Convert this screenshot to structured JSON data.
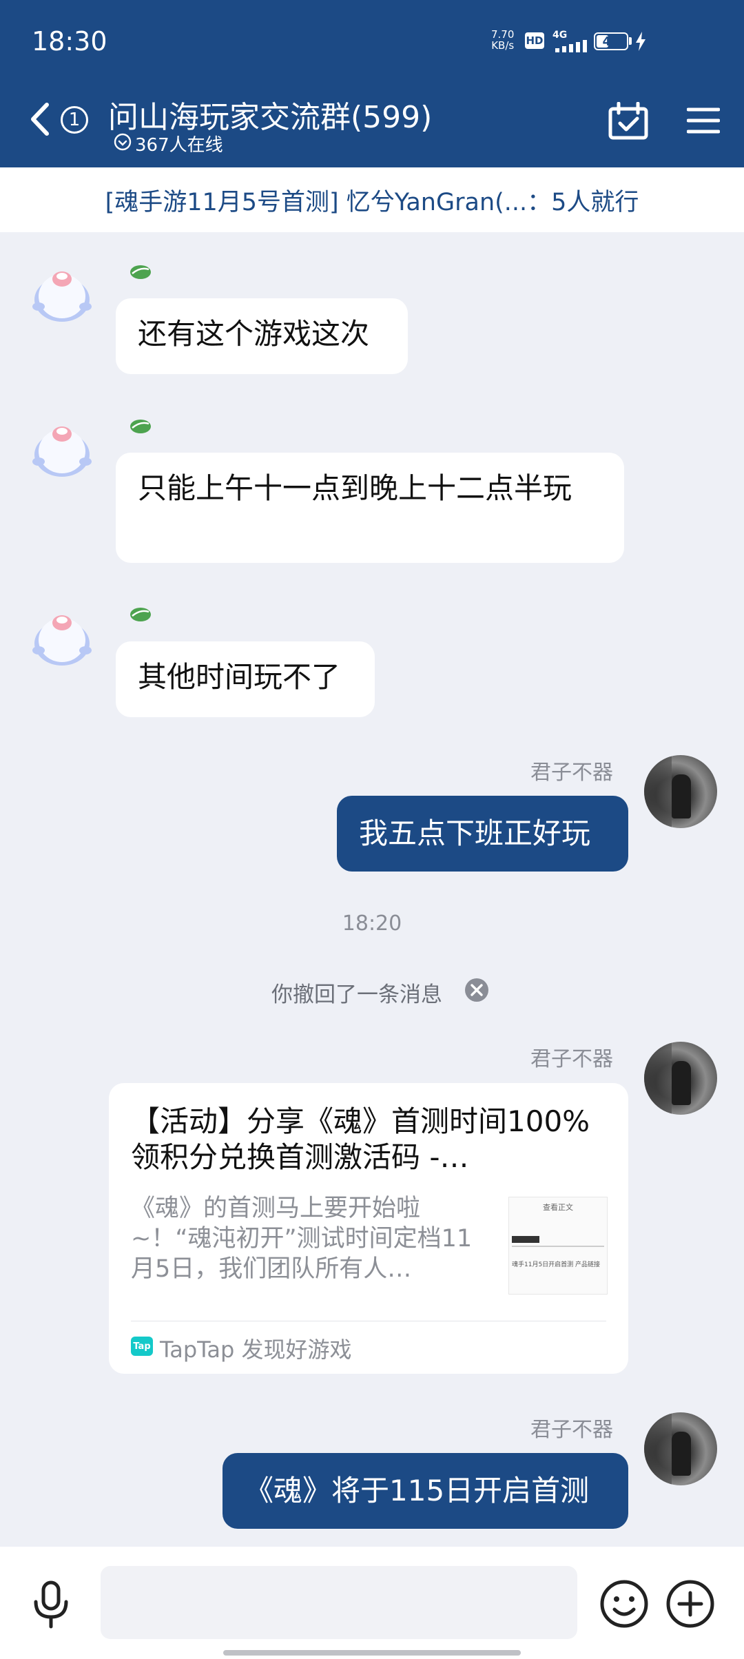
{
  "status_bar": {
    "time": "18:30",
    "net_speed_value": "7.70",
    "net_speed_unit": "KB/s",
    "hd": "HD",
    "network": "4G",
    "battery": "40",
    "battery_level": 0.4
  },
  "header": {
    "unread_count": "1",
    "title": "问山海玩家交流群(599)",
    "online": "367人在线"
  },
  "announcement": "[魂手游11月5号首测] 忆兮YanGran(...：5人就行",
  "messages": [
    {
      "text": "还有这个游戏这次"
    },
    {
      "text": "只能上午十一点到晚上十二点半玩"
    },
    {
      "text": "其他时间玩不了"
    },
    {
      "sender": "君子不器",
      "text": "我五点下班正好玩"
    },
    {
      "sender": "君子不器"
    },
    {
      "sender": "君子不器",
      "text": "《魂》将于115日开启首测"
    }
  ],
  "time_divider": "18:20",
  "recall_notice": "你撤回了一条消息",
  "share_card": {
    "title": "【活动】分享《魂》首测时间100%领积分兑换首测激活码 -…",
    "description": "《魂》的首测马上要开始啦~！“魂沌初开”测试时间定档11月5日，我们团队所有人…",
    "thumb_title": "查看正文",
    "thumb_text": "魂手11月5日开启首测 产品链接",
    "source_logo": "Tap",
    "source": "TapTap 发现好游戏"
  },
  "input": {
    "placeholder": ""
  },
  "colors": {
    "primary": "#1c4a85",
    "background": "#eef0f6"
  }
}
